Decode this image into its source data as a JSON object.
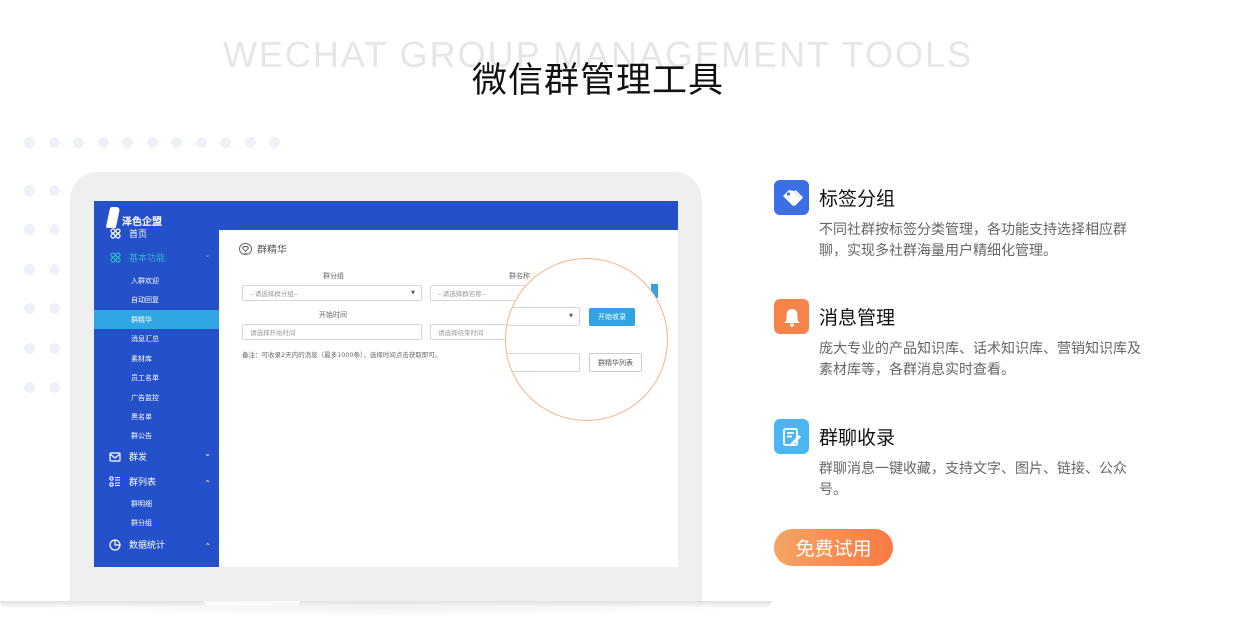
{
  "header": {
    "bg_title": "WECHAT GROUP MANAGEMENT TOOLS",
    "title": "微信群管理工具"
  },
  "app": {
    "logo_text": "泽色企盟",
    "nav": [
      {
        "label": "首页",
        "icon": "grid-icon",
        "level": "top"
      },
      {
        "label": "基本功能",
        "icon": "grid-icon",
        "level": "top",
        "chevron": "down"
      },
      {
        "label": "入群欢迎",
        "level": "sub"
      },
      {
        "label": "自动回复",
        "level": "sub"
      },
      {
        "label": "群精华",
        "level": "sub",
        "active": true
      },
      {
        "label": "消息汇总",
        "level": "sub"
      },
      {
        "label": "素材库",
        "level": "sub"
      },
      {
        "label": "员工名单",
        "level": "sub"
      },
      {
        "label": "广告监控",
        "level": "sub"
      },
      {
        "label": "黑名单",
        "level": "sub"
      },
      {
        "label": "群公告",
        "level": "sub"
      },
      {
        "label": "群发",
        "icon": "mail-icon",
        "level": "top",
        "chevron": "down"
      },
      {
        "label": "群列表",
        "icon": "list-icon",
        "level": "top",
        "chevron": "up"
      },
      {
        "label": "群明细",
        "level": "sub"
      },
      {
        "label": "群分组",
        "level": "sub"
      },
      {
        "label": "数据统计",
        "icon": "pie-icon",
        "level": "top",
        "chevron": "up"
      }
    ],
    "page_title": "群精华",
    "form": {
      "group_label": "群分组",
      "group_placeholder": "--请选择群分组--",
      "name_label": "群名称",
      "name_placeholder": "--请选择群名称--",
      "start_label": "开始时间",
      "start_placeholder": "请选择开始时间",
      "end_placeholder": "请选择结束时间",
      "note": "备注：可收录2天内的消息（最多1000条），选择时间点击获取即可。",
      "start_button": "开始收录",
      "list_button": "群精华列表"
    }
  },
  "features": [
    {
      "title": "标签分组",
      "icon": "tag-icon",
      "color": "#3c6ee6",
      "desc": "不同社群按标签分类管理，各功能支持选择相应群聊，实现多社群海量用户精细化管理。"
    },
    {
      "title": "消息管理",
      "icon": "bell-icon",
      "color": "#f5844a",
      "desc": "庞大专业的产品知识库、话术知识库、营销知识库及素材库等，各群消息实时查看。"
    },
    {
      "title": "群聊收录",
      "icon": "edit-note-icon",
      "color": "#4cb6f2",
      "desc": "群聊消息一键收藏，支持文字、图片、链接、公众号。"
    }
  ],
  "cta": {
    "label": "免费试用"
  }
}
